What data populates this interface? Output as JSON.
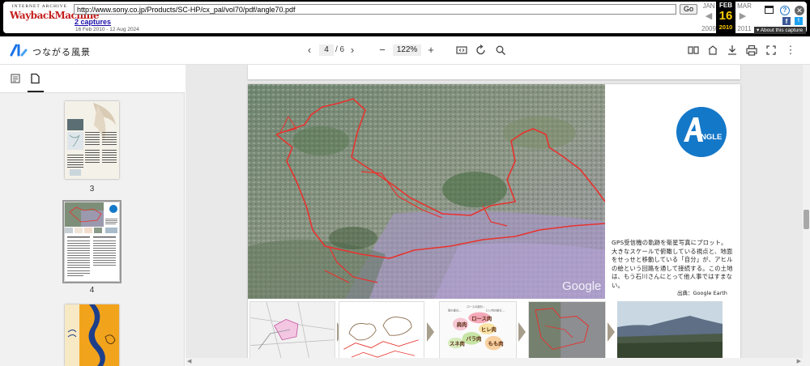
{
  "wayback": {
    "logo_top": "INTERNET ARCHIVE",
    "logo_main": "WaybackMachine",
    "url": "http://www.sony.co.jp/Products/SC-HP/cx_pal/vol70/pdf/angle70.pdf",
    "go_label": "Go",
    "captures_label": "2 captures",
    "date_range": "16 Feb 2010 - 12 Aug 2024",
    "prev_month": "JAN",
    "current_month": "FEB",
    "next_month": "MAR",
    "current_day": "16",
    "prev_year": "2009",
    "current_year": "2010",
    "next_year": "2011",
    "about_label": "▾ About this capture"
  },
  "viewer": {
    "doc_title": "つながる風景",
    "current_page": "4",
    "total_pages": "/ 6",
    "zoom": "122%"
  },
  "sidebar": {
    "thumbnails": [
      {
        "label": "3"
      },
      {
        "label": "4"
      }
    ]
  },
  "page": {
    "caption": "GPS受信機の軌跡を衛星写真にプロット。大きなスケールで俯瞰している視点と、地面をせっせと移動している「自分」が、アヒルの絵という回路を通して接続する。この土地は、もう石川さんにとって他人事ではすまない。",
    "source": "出典：Google Earth",
    "watermark": "Google",
    "logo_text": "NGLE",
    "strip_labels": [
      "ロース肉",
      "肩肉",
      "ヒレ肉",
      "もも肉",
      "バラ肉",
      "スネ肉"
    ]
  },
  "colors": {
    "route": "#e8322e",
    "angle_blue": "#1478c8",
    "wayback_red": "#c41e1e",
    "wayback_yellow": "#ffcc00"
  }
}
